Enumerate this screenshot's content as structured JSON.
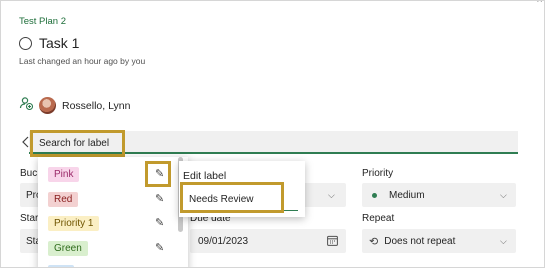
{
  "task": {
    "plan_name": "Test Plan 2",
    "title": "Task 1",
    "last_changed": "Last changed an hour ago by you",
    "assignee": "Rossello, Lynn"
  },
  "label_search": {
    "placeholder": "Search for label"
  },
  "labels": [
    {
      "name": "Pink",
      "color": "#f8d5ea",
      "text_color": "#9b2a6a"
    },
    {
      "name": "Red",
      "color": "#f3d1d1",
      "text_color": "#8a1f1f"
    },
    {
      "name": "Priority 1",
      "color": "#fbefc4",
      "text_color": "#6f5400"
    },
    {
      "name": "Green",
      "color": "#d9efce",
      "text_color": "#2f6b1c"
    }
  ],
  "edit_popover": {
    "title": "Edit label",
    "value": "Needs Review"
  },
  "fields": {
    "bucket_label_partial": "Buc",
    "bucket_value_partial": "Pro",
    "start_label_partial": "Star",
    "start_value_partial": "Sta",
    "priority_label": "Priority",
    "priority_value": "Medium",
    "due_label": "Due date",
    "due_value": "09/01/2023",
    "repeat_label": "Repeat",
    "repeat_value": "Does not repeat"
  },
  "colors": {
    "accent_green": "#2f7d52",
    "highlight_gold": "#c19a2d"
  },
  "icons": [
    "add-assignee-icon",
    "label-tag-icon",
    "pencil-icon",
    "calendar-icon",
    "repeat-icon",
    "chevron-down-icon"
  ]
}
